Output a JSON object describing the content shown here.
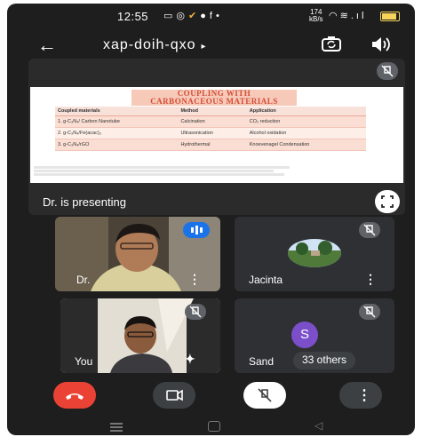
{
  "status_bar": {
    "time": "12:55",
    "net_speed_value": "174",
    "net_speed_unit": "kB/s"
  },
  "header": {
    "meeting_code": "xap-doih-qxo",
    "meeting_code_arrow": "▸"
  },
  "presentation": {
    "slide_title_line1": "COUPLING WITH",
    "slide_title_line2": "CARBONACEOUS MATERIALS",
    "table_headers": [
      "Coupled materials",
      "Method",
      "Application"
    ],
    "table_rows": [
      [
        "1. g-C₃N₄/ Carbon Nanotube",
        "Calcination",
        "CO₂ reduction"
      ],
      [
        "2. g-C₃N₄/Fe(acac)₃",
        "Ultrasonication",
        "Alcohol oxidation"
      ],
      [
        "3. g-C₃N₄/rGO",
        "Hydrothermal",
        "Knoevenagel Condensation"
      ]
    ],
    "presenting_label": "Dr. is presenting"
  },
  "participants": [
    {
      "name": "Dr."
    },
    {
      "name": "Jacinta"
    },
    {
      "name": "You"
    },
    {
      "name": "Sand",
      "extra": "33 others",
      "avatar_letter": "S"
    }
  ],
  "colors": {
    "end_call": "#ea4335",
    "speaking_indicator": "#1a73e8",
    "avatar_purple": "#7b4fc9",
    "slide_accent": "#d34e38"
  }
}
